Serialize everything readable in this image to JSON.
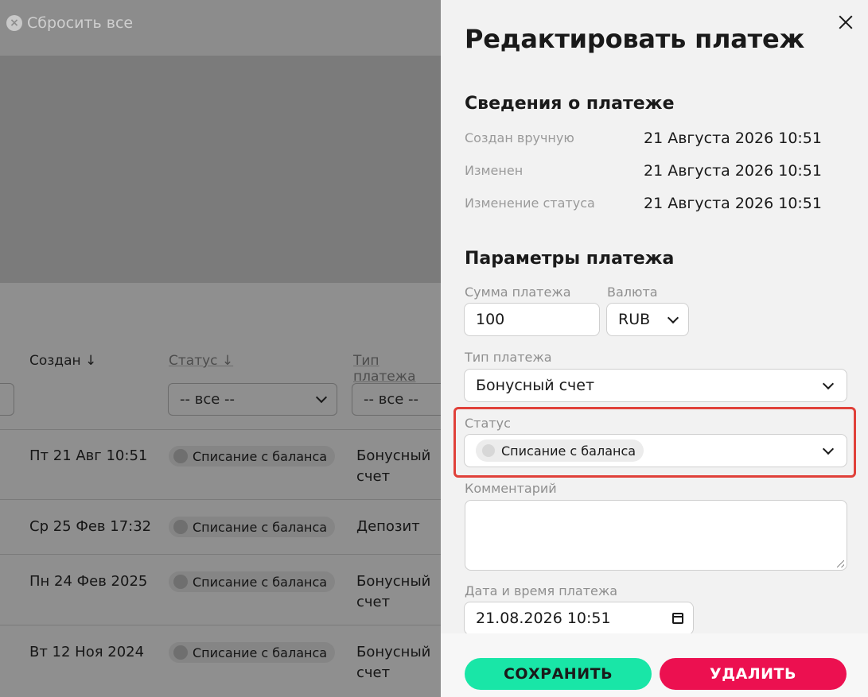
{
  "background": {
    "reset_label": "Сбросить все",
    "columns": {
      "created": "Создан ↓",
      "status": "Статус ↓",
      "type": "Тип платежа"
    },
    "filters": {
      "status_value": "-- все --",
      "type_value": "-- все --"
    },
    "rows": [
      {
        "date": "Пт 21 Авг 10:51",
        "status": "Списание с баланса",
        "type_line1": "Бонусный",
        "type_line2": "счет"
      },
      {
        "date": "Ср 25 Фев 17:32",
        "status": "Списание с баланса",
        "type_line1": "Депозит",
        "type_line2": ""
      },
      {
        "date": "Пн 24 Фев 2025",
        "status": "Списание с баланса",
        "type_line1": "Бонусный",
        "type_line2": "счет"
      },
      {
        "date": "Вт 12 Ноя 2024",
        "status": "Списание с баланса",
        "type_line1": "Бонусный",
        "type_line2": "счет"
      }
    ]
  },
  "drawer": {
    "title": "Редактировать платеж",
    "info_section_title": "Сведения о платеже",
    "info": [
      {
        "label": "Создан вручную",
        "value": "21 Августа 2026 10:51"
      },
      {
        "label": "Изменен",
        "value": "21 Августа 2026 10:51"
      },
      {
        "label": "Изменение статуса",
        "value": "21 Августа 2026 10:51"
      }
    ],
    "params_section_title": "Параметры платежа",
    "amount": {
      "label": "Сумма платежа",
      "value": "100"
    },
    "currency": {
      "label": "Валюта",
      "value": "RUB"
    },
    "payment_type": {
      "label": "Тип платежа",
      "value": "Бонусный счет"
    },
    "status": {
      "label": "Статус",
      "value": "Списание с баланса"
    },
    "comment": {
      "label": "Комментарий",
      "value": ""
    },
    "datetime": {
      "label": "Дата и время платежа",
      "value": "21.08.2026 10:51"
    },
    "save_label": "СОХРАНИТЬ",
    "delete_label": "УДАЛИТЬ"
  },
  "colors": {
    "save": "#19e6a7",
    "delete": "#ec1050",
    "highlight": "#e0413a"
  }
}
